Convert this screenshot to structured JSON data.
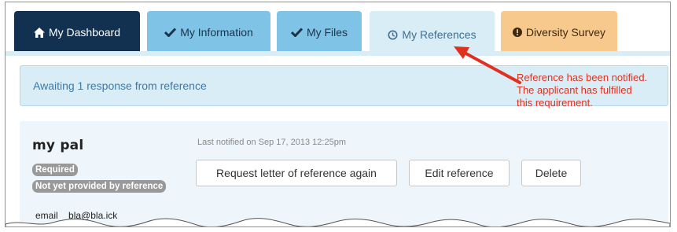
{
  "tabs": [
    {
      "label": "My Dashboard",
      "icon": "home-icon"
    },
    {
      "label": "My Information",
      "icon": "checkmark-icon"
    },
    {
      "label": "My Files",
      "icon": "checkmark-icon"
    },
    {
      "label": "My References",
      "icon": "clock-icon",
      "active": true
    },
    {
      "label": "Diversity Survey",
      "icon": "exclamation-circle-icon"
    }
  ],
  "alert": {
    "text": "Awaiting 1 response from reference"
  },
  "annotation": {
    "text": "Reference has been notified. The applicant has fulfilled this requirement."
  },
  "reference": {
    "name": "my pal",
    "badges": [
      "Required",
      "Not yet provided by reference"
    ],
    "last_notified": "Last notified on Sep 17, 2013 12:25pm",
    "buttons": {
      "request": "Request letter of reference again",
      "edit": "Edit reference",
      "delete": "Delete"
    },
    "email_label": "email",
    "email_value": "bla@bla.ick"
  },
  "colors": {
    "dashboard_tab": "#12304f",
    "completed_tab": "#7fc3e6",
    "active_tab": "#d9edf7",
    "survey_tab": "#f8c98c",
    "badge": "#999999",
    "annotation": "#e0311f"
  }
}
